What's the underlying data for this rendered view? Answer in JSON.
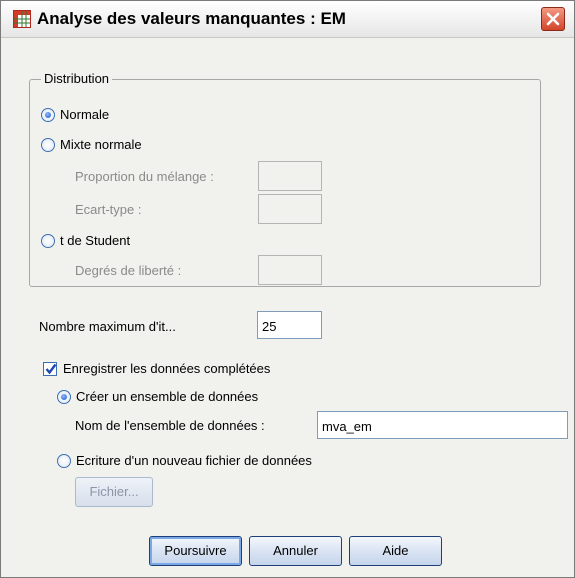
{
  "window": {
    "title": "Analyse des valeurs manquantes : EM"
  },
  "distribution": {
    "legend": "Distribution",
    "options": [
      {
        "label": "Normale",
        "selected": true
      },
      {
        "label": "Mixte normale",
        "selected": false
      },
      {
        "label": "t de Student",
        "selected": false
      }
    ],
    "mixture_proportion_label": "Proportion du mélange :",
    "mixture_stddev_label": "Ecart-type :",
    "dof_label": "Degrés de liberté :"
  },
  "iterations": {
    "label": "Nombre maximum d'it...",
    "value": "25"
  },
  "save": {
    "checkbox_label": "Enregistrer les données complétées",
    "checked": true,
    "create_dataset_label": "Créer un ensemble de données",
    "dataset_name_label": "Nom de l'ensemble de données :",
    "dataset_name_value": "mva_em",
    "new_file_label": "Ecriture d'un nouveau fichier de données",
    "file_button": "Fichier..."
  },
  "buttons": {
    "continue": "Poursuivre",
    "cancel": "Annuler",
    "help": "Aide"
  }
}
